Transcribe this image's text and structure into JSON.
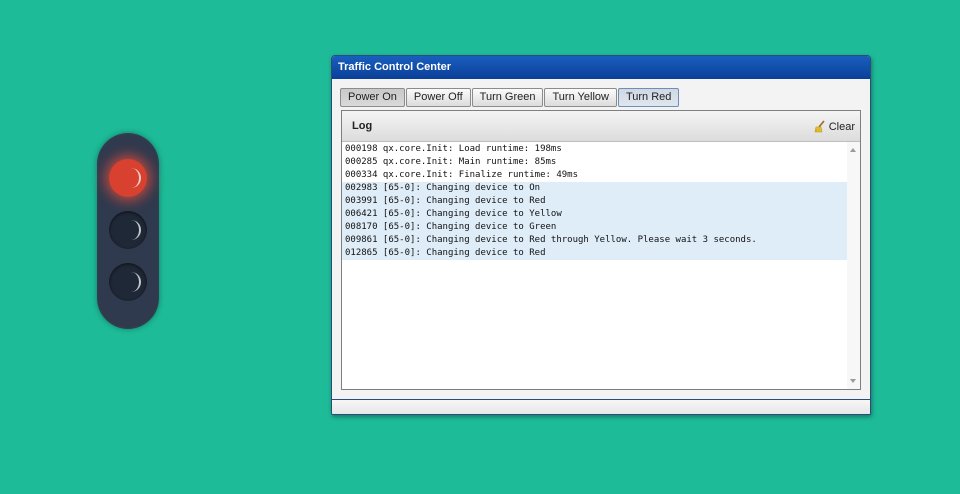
{
  "traffic_light": {
    "lamps": [
      {
        "color": "red",
        "state": "on",
        "hex": "#d8412f"
      },
      {
        "color": "yellow",
        "state": "off"
      },
      {
        "color": "green",
        "state": "off"
      }
    ]
  },
  "window": {
    "title": "Traffic Control Center",
    "toolbar": {
      "power_on": "Power On",
      "power_off": "Power Off",
      "turn_green": "Turn Green",
      "turn_yellow": "Turn Yellow",
      "turn_red": "Turn Red"
    },
    "log": {
      "title": "Log",
      "clear_label": "Clear",
      "lines": [
        {
          "text": "000198 qx.core.Init: Load runtime: 198ms",
          "highlight": false
        },
        {
          "text": "000285 qx.core.Init: Main runtime: 85ms",
          "highlight": false
        },
        {
          "text": "000334 qx.core.Init: Finalize runtime: 49ms",
          "highlight": false
        },
        {
          "text": "002983 [65-0]: Changing device to On",
          "highlight": true
        },
        {
          "text": "003991 [65-0]: Changing device to Red",
          "highlight": true
        },
        {
          "text": "006421 [65-0]: Changing device to Yellow",
          "highlight": true
        },
        {
          "text": "008170 [65-0]: Changing device to Green",
          "highlight": true
        },
        {
          "text": "009861 [65-0]: Changing device to Red through Yellow. Please wait 3 seconds.",
          "highlight": true
        },
        {
          "text": "012865 [65-0]: Changing device to Red",
          "highlight": true
        }
      ]
    }
  },
  "colors": {
    "background": "#1dbb98",
    "titlebar": "#0a3f98",
    "log_highlight": "#dfedf8"
  }
}
